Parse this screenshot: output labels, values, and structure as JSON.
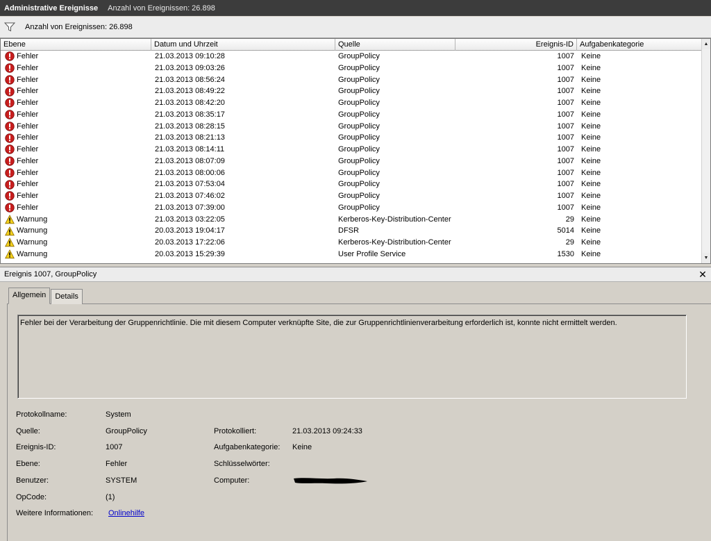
{
  "window": {
    "title": "Administrative Ereignisse",
    "count_text": "Anzahl von Ereignissen: 26.898"
  },
  "filter": {
    "icon": "filter-funnel-icon",
    "text": "Anzahl von Ereignissen: 26.898"
  },
  "grid": {
    "columns": [
      "Ebene",
      "Datum und Uhrzeit",
      "Quelle",
      "Ereignis-ID",
      "Aufgabenkategorie"
    ],
    "rows": [
      {
        "level": "Fehler",
        "icon": "error-icon",
        "datetime": "21.03.2013 09:10:28",
        "source": "GroupPolicy",
        "id": "1007",
        "category": "Keine"
      },
      {
        "level": "Fehler",
        "icon": "error-icon",
        "datetime": "21.03.2013 09:03:26",
        "source": "GroupPolicy",
        "id": "1007",
        "category": "Keine"
      },
      {
        "level": "Fehler",
        "icon": "error-icon",
        "datetime": "21.03.2013 08:56:24",
        "source": "GroupPolicy",
        "id": "1007",
        "category": "Keine"
      },
      {
        "level": "Fehler",
        "icon": "error-icon",
        "datetime": "21.03.2013 08:49:22",
        "source": "GroupPolicy",
        "id": "1007",
        "category": "Keine"
      },
      {
        "level": "Fehler",
        "icon": "error-icon",
        "datetime": "21.03.2013 08:42:20",
        "source": "GroupPolicy",
        "id": "1007",
        "category": "Keine"
      },
      {
        "level": "Fehler",
        "icon": "error-icon",
        "datetime": "21.03.2013 08:35:17",
        "source": "GroupPolicy",
        "id": "1007",
        "category": "Keine"
      },
      {
        "level": "Fehler",
        "icon": "error-icon",
        "datetime": "21.03.2013 08:28:15",
        "source": "GroupPolicy",
        "id": "1007",
        "category": "Keine"
      },
      {
        "level": "Fehler",
        "icon": "error-icon",
        "datetime": "21.03.2013 08:21:13",
        "source": "GroupPolicy",
        "id": "1007",
        "category": "Keine"
      },
      {
        "level": "Fehler",
        "icon": "error-icon",
        "datetime": "21.03.2013 08:14:11",
        "source": "GroupPolicy",
        "id": "1007",
        "category": "Keine"
      },
      {
        "level": "Fehler",
        "icon": "error-icon",
        "datetime": "21.03.2013 08:07:09",
        "source": "GroupPolicy",
        "id": "1007",
        "category": "Keine"
      },
      {
        "level": "Fehler",
        "icon": "error-icon",
        "datetime": "21.03.2013 08:00:06",
        "source": "GroupPolicy",
        "id": "1007",
        "category": "Keine"
      },
      {
        "level": "Fehler",
        "icon": "error-icon",
        "datetime": "21.03.2013 07:53:04",
        "source": "GroupPolicy",
        "id": "1007",
        "category": "Keine"
      },
      {
        "level": "Fehler",
        "icon": "error-icon",
        "datetime": "21.03.2013 07:46:02",
        "source": "GroupPolicy",
        "id": "1007",
        "category": "Keine"
      },
      {
        "level": "Fehler",
        "icon": "error-icon",
        "datetime": "21.03.2013 07:39:00",
        "source": "GroupPolicy",
        "id": "1007",
        "category": "Keine"
      },
      {
        "level": "Warnung",
        "icon": "warning-icon",
        "datetime": "21.03.2013 03:22:05",
        "source": "Kerberos-Key-Distribution-Center",
        "id": "29",
        "category": "Keine"
      },
      {
        "level": "Warnung",
        "icon": "warning-icon",
        "datetime": "20.03.2013 19:04:17",
        "source": "DFSR",
        "id": "5014",
        "category": "Keine"
      },
      {
        "level": "Warnung",
        "icon": "warning-icon",
        "datetime": "20.03.2013 17:22:06",
        "source": "Kerberos-Key-Distribution-Center",
        "id": "29",
        "category": "Keine"
      },
      {
        "level": "Warnung",
        "icon": "warning-icon",
        "datetime": "20.03.2013 15:29:39",
        "source": "User Profile Service",
        "id": "1530",
        "category": "Keine"
      }
    ]
  },
  "detail": {
    "header": "Ereignis 1007, GroupPolicy",
    "close_icon": "close-icon",
    "tabs": [
      "Allgemein",
      "Details"
    ],
    "message": "Fehler bei der Verarbeitung der Gruppenrichtlinie. Die mit diesem Computer verknüpfte Site, die zur Gruppenrichtlinienverarbeitung erforderlich ist, konnte nicht ermittelt werden.",
    "labels": {
      "log_name": "Protokollname:",
      "source": "Quelle:",
      "event_id": "Ereignis-ID:",
      "level": "Ebene:",
      "user": "Benutzer:",
      "opcode": "OpCode:",
      "more_info": "Weitere Informationen:",
      "logged": "Protokolliert:",
      "task_category": "Aufgabenkategorie:",
      "keywords": "Schlüsselwörter:",
      "computer": "Computer:"
    },
    "values": {
      "log_name": "System",
      "source": "GroupPolicy",
      "event_id": "1007",
      "level": "Fehler",
      "user": "SYSTEM",
      "opcode": "(1)",
      "more_info_link": "Onlinehilfe",
      "logged": "21.03.2013 09:24:33",
      "task_category": "Keine",
      "keywords": ""
    }
  },
  "colors": {
    "titlebar": "#3c3c3c",
    "panel": "#d4d0c8",
    "error": "#c81e1e",
    "warning": "#f5d21e",
    "link": "#0000cc"
  }
}
